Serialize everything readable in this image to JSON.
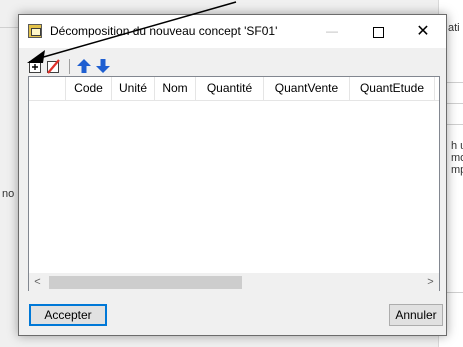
{
  "background": {
    "right_snippets": [
      "ati",
      "h u",
      "mo",
      "mp"
    ],
    "left_snippet": "no"
  },
  "dialog": {
    "title": "Décomposition du nouveau concept 'SF01'",
    "controls": {
      "minimize": "—",
      "maximize": "",
      "close": "✕"
    },
    "toolbar": {
      "icons": [
        "add-icon",
        "delete-icon",
        "move-up-icon",
        "move-down-icon"
      ],
      "colors": {
        "delete": "#e0302a",
        "arrows": "#1f5fd1"
      }
    },
    "grid": {
      "columns": [
        "Code",
        "Unité",
        "Nom",
        "Quantité",
        "QuantVente",
        "QuantEtude"
      ],
      "rows": []
    },
    "scrollbar": {
      "left_arrow": "<",
      "right_arrow": ">"
    },
    "buttons": {
      "accept": "Accepter",
      "cancel": "Annuler"
    },
    "accent_color": "#0078d7"
  }
}
